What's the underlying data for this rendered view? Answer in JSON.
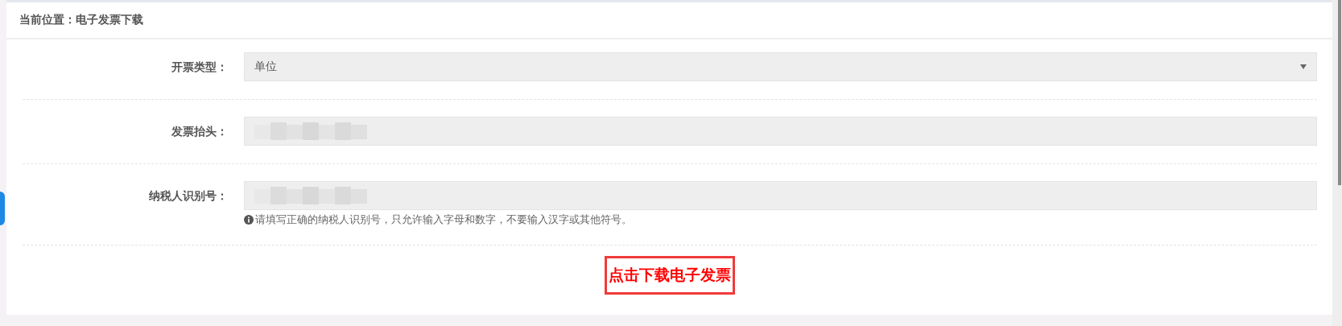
{
  "breadcrumb": "当前位置：电子发票下载",
  "form": {
    "fields": [
      {
        "kind": "select",
        "label": "开票类型：",
        "value": "单位",
        "disabled": true
      },
      {
        "kind": "text",
        "label": "发票抬头：",
        "redacted": true,
        "disabled": true
      },
      {
        "kind": "text",
        "label": "纳税人识别号：",
        "redacted": true,
        "disabled": true,
        "help": "请填写正确的纳税人识别号，只允许输入字母和数字，不要输入汉字或其他符号。"
      }
    ]
  },
  "download_button": "点击下载电子发票"
}
